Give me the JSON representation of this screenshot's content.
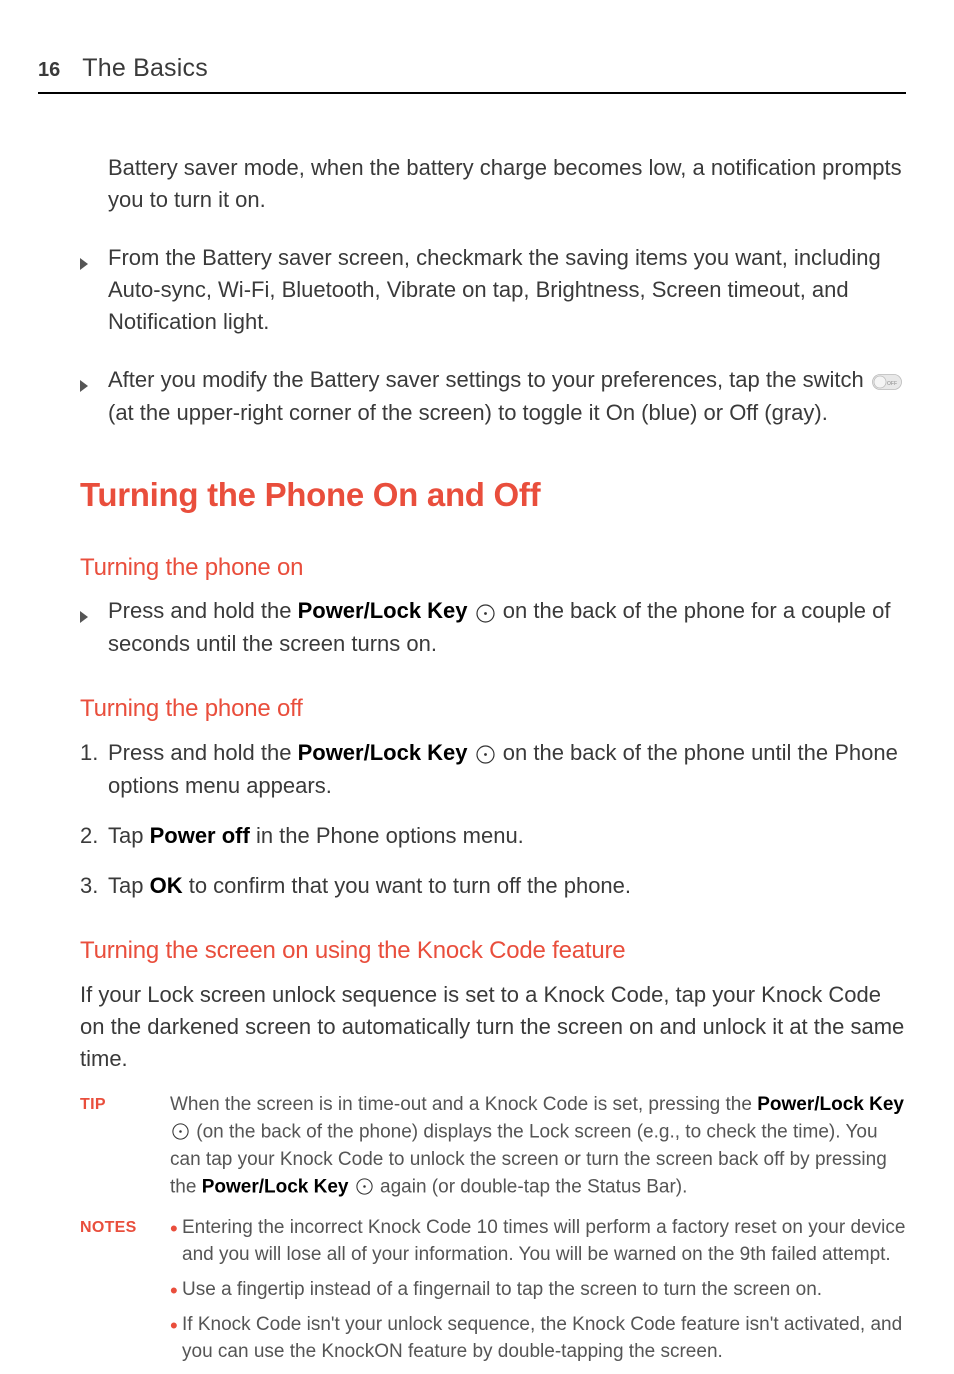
{
  "header": {
    "page_number": "16",
    "title": "The Basics"
  },
  "intro": "Battery saver mode, when the battery charge becomes low, a notification prompts you to turn it on.",
  "bullets": [
    "From the Battery saver screen, checkmark the saving items you want, including Auto-sync, Wi-Fi, Bluetooth, Vibrate on tap, Brightness, Screen timeout, and Notification light.",
    {
      "pre": "After you modify the Battery saver settings to your preferences, tap the switch ",
      "post": " (at the upper-right corner of the screen) to toggle it On (blue) or Off (gray)."
    }
  ],
  "main_heading": "Turning the Phone On and Off",
  "section_on": {
    "title": "Turning the phone on",
    "item": {
      "pre": "Press and hold the ",
      "bold": "Power/Lock Key",
      "post": " on the back of the phone for a couple of seconds until the screen turns on."
    }
  },
  "section_off": {
    "title": "Turning the phone off",
    "items": [
      {
        "num": "1.",
        "pre": "Press and hold the ",
        "bold": "Power/Lock Key",
        "post": " on the back of the phone until the Phone options menu appears."
      },
      {
        "num": "2.",
        "pre": "Tap ",
        "bold": "Power off",
        "post": " in the Phone options menu."
      },
      {
        "num": "3.",
        "pre": "Tap ",
        "bold": "OK",
        "post": " to confirm that you want to turn off the phone."
      }
    ]
  },
  "section_knock": {
    "title": "Turning the screen on using the Knock Code feature",
    "body": "If your Lock screen unlock sequence is set to a Knock Code, tap your Knock Code on the darkened screen to automatically turn the screen on and unlock it at the same time."
  },
  "tip": {
    "label": "TIP",
    "part1": "When the screen is in time-out and a Knock Code is set, pressing the ",
    "bold1": "Power/Lock Key",
    "part2": " (on the back of the phone) displays the Lock screen (e.g., to check the time). You can tap your Knock Code to unlock the screen or turn the screen back off by pressing the ",
    "bold2": "Power/Lock Key",
    "part3": " again (or double-tap the Status Bar)."
  },
  "notes": {
    "label": "NOTES",
    "items": [
      "Entering the incorrect Knock Code 10 times will perform a factory reset on your device and you will lose all of your information. You will be warned on the 9th failed attempt.",
      "Use a fingertip instead of a fingernail to tap the screen to turn the screen on.",
      "If Knock Code isn't your unlock sequence, the Knock Code feature isn't activated, and you can use the KnockON feature by double-tapping the screen."
    ]
  },
  "off_label": "OFF"
}
